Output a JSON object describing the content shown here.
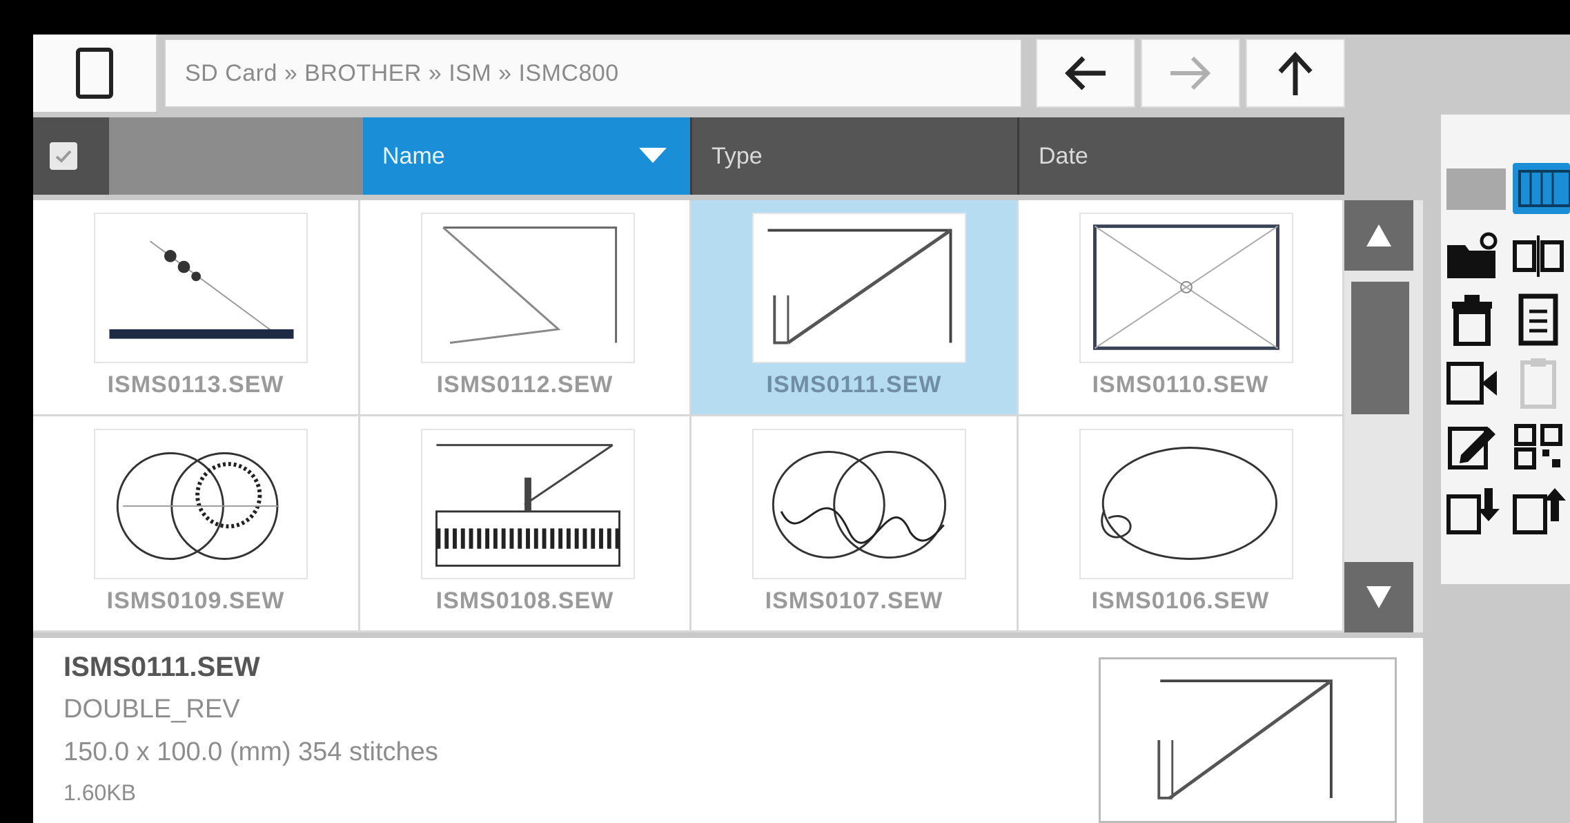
{
  "breadcrumb": "SD Card » BROTHER » ISM » ISMC800",
  "header": {
    "name_label": "Name",
    "type_label": "Type",
    "date_label": "Date"
  },
  "files": [
    {
      "name": "ISMS0113.SEW",
      "selected": false
    },
    {
      "name": "ISMS0112.SEW",
      "selected": false
    },
    {
      "name": "ISMS0111.SEW",
      "selected": true
    },
    {
      "name": "ISMS0110.SEW",
      "selected": false
    },
    {
      "name": "ISMS0109.SEW",
      "selected": false
    },
    {
      "name": "ISMS0108.SEW",
      "selected": false
    },
    {
      "name": "ISMS0107.SEW",
      "selected": false
    },
    {
      "name": "ISMS0106.SEW",
      "selected": false
    }
  ],
  "info": {
    "file_name": "ISMS0111.SEW",
    "pattern_name": "DOUBLE_REV",
    "dimensions": "150.0 x 100.0 (mm) 354 stitches",
    "size": "1.60KB"
  },
  "colors": {
    "accent": "#1a8fd8",
    "selected": "#b6dcf2",
    "header": "#555555"
  },
  "icons": [
    "file-icon",
    "back-arrow-icon",
    "forward-arrow-icon",
    "up-arrow-icon",
    "new-folder-icon",
    "delete-icon",
    "convert-icon",
    "edit-icon",
    "import-icon",
    "export-icon"
  ]
}
